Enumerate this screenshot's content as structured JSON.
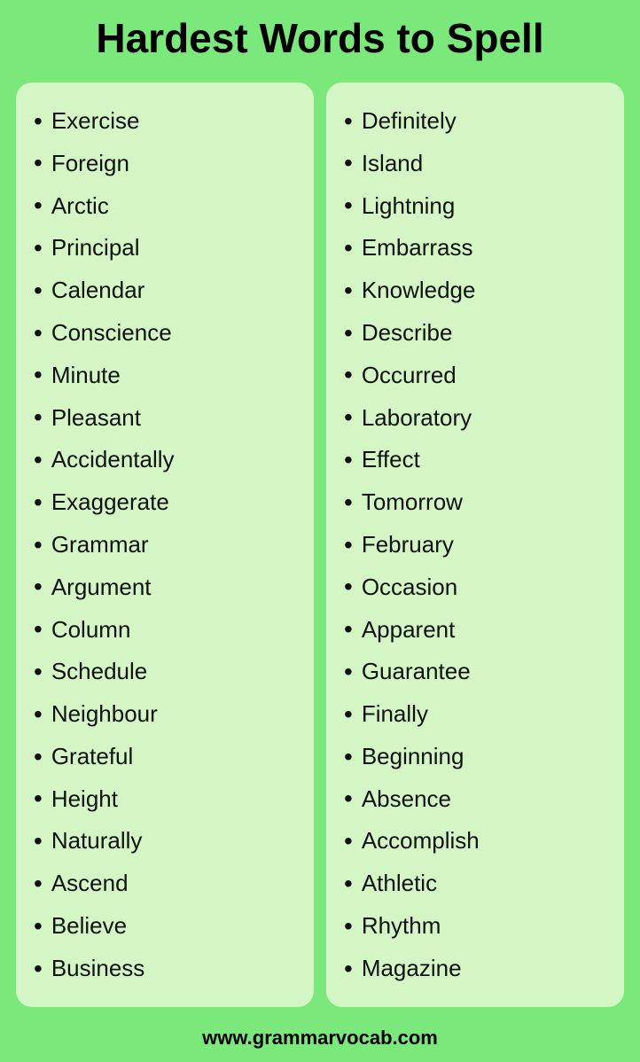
{
  "header": {
    "title": "Hardest Words to Spell"
  },
  "left_column": {
    "words": [
      "Exercise",
      "Foreign",
      "Arctic",
      "Principal",
      "Calendar",
      "Conscience",
      "Minute",
      "Pleasant",
      "Accidentally",
      "Exaggerate",
      "Grammar",
      "Argument",
      "Column",
      "Schedule",
      "Neighbour",
      "Grateful",
      "Height",
      "Naturally",
      "Ascend",
      "Believe",
      "Business"
    ]
  },
  "right_column": {
    "words": [
      "Definitely",
      "Island",
      "Lightning",
      "Embarrass",
      "Knowledge",
      "Describe",
      "Occurred",
      "Laboratory",
      "Effect",
      "Tomorrow",
      "February",
      "Occasion",
      "Apparent",
      "Guarantee",
      "Finally",
      "Beginning",
      "Absence",
      "Accomplish",
      "Athletic",
      "Rhythm",
      "Magazine"
    ]
  },
  "footer": {
    "url": "www.grammarvocab.com"
  }
}
